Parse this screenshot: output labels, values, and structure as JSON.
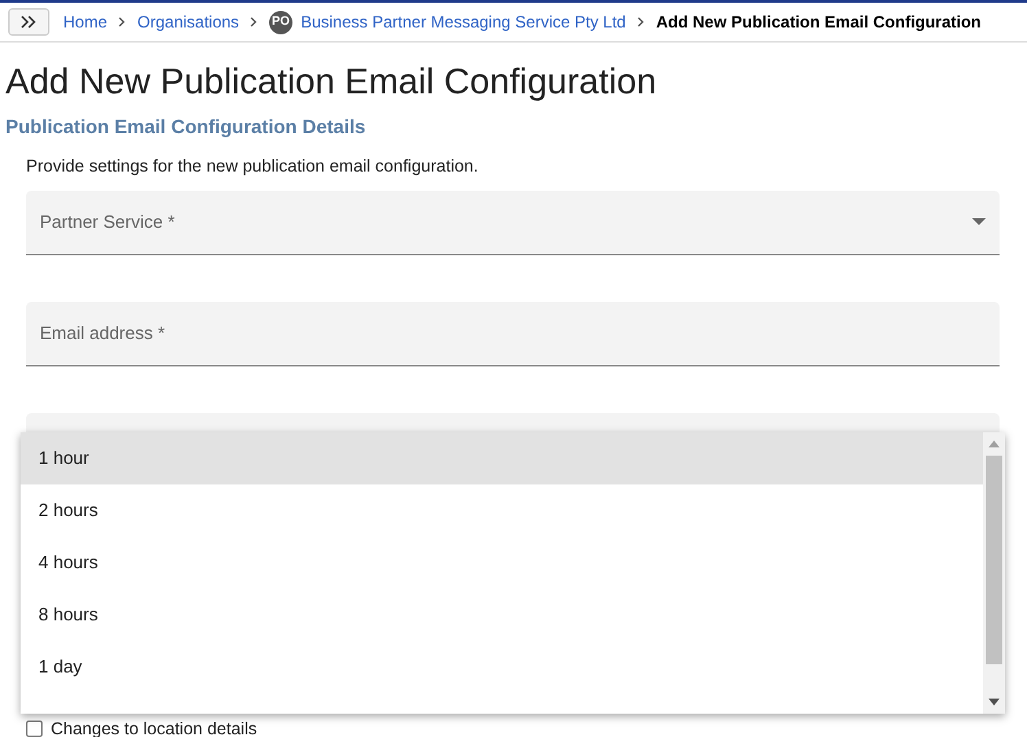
{
  "breadcrumb": [
    {
      "label": "Home",
      "current": false
    },
    {
      "label": "Organisations",
      "current": false
    },
    {
      "label": "Business Partner Messaging Service Pty Ltd",
      "avatar": "PO",
      "current": false
    },
    {
      "label": "Add New Publication Email Configuration",
      "current": true
    }
  ],
  "title": "Add New Publication Email Configuration",
  "section": {
    "title": "Publication Email Configuration Details",
    "description": "Provide settings for the new publication email configuration."
  },
  "fields": [
    {
      "kind": "select",
      "label": "Partner Service *"
    },
    {
      "kind": "text",
      "label": "Email address *"
    },
    {
      "kind": "select"
    }
  ],
  "checkbox": {
    "label": "Changes to location details",
    "checked": false
  },
  "dropdown": {
    "options": [
      {
        "label": "1 hour",
        "selected": true
      },
      {
        "label": "2 hours",
        "selected": false
      },
      {
        "label": "4 hours",
        "selected": false
      },
      {
        "label": "8 hours",
        "selected": false
      },
      {
        "label": "1 day",
        "selected": false
      }
    ]
  }
}
